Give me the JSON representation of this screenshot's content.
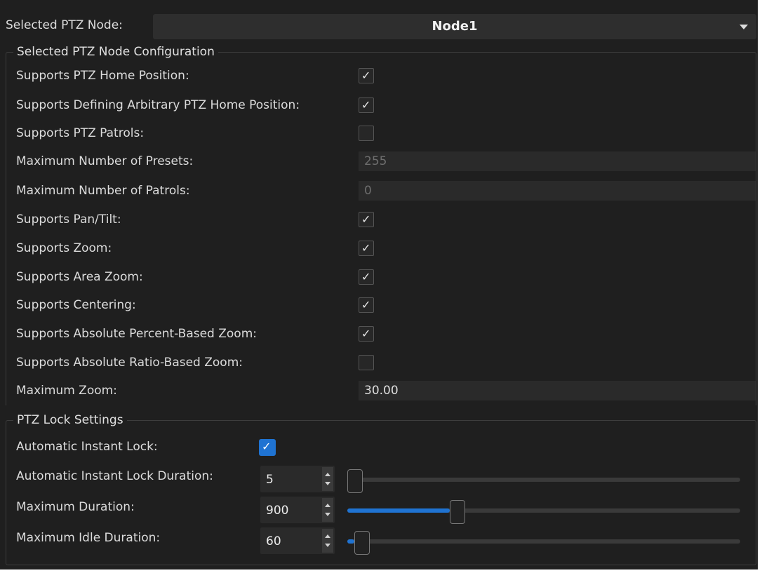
{
  "node": {
    "label": "Selected PTZ Node:",
    "selected": "Node1"
  },
  "config": {
    "legend": "Selected PTZ Node Configuration",
    "rows": [
      {
        "label": "Supports PTZ Home Position:",
        "type": "checkbox",
        "checked": true
      },
      {
        "label": "Supports Defining Arbitrary PTZ Home Position:",
        "type": "checkbox",
        "checked": true
      },
      {
        "label": "Supports PTZ Patrols:",
        "type": "checkbox",
        "checked": false
      },
      {
        "label": "Maximum Number of Presets:",
        "type": "field",
        "value": "255"
      },
      {
        "label": "Maximum Number of Patrols:",
        "type": "field",
        "value": "0"
      },
      {
        "label": "Supports Pan/Tilt:",
        "type": "checkbox",
        "checked": true
      },
      {
        "label": "Supports Zoom:",
        "type": "checkbox",
        "checked": true
      },
      {
        "label": "Supports Area Zoom:",
        "type": "checkbox",
        "checked": true
      },
      {
        "label": "Supports Centering:",
        "type": "checkbox",
        "checked": true
      },
      {
        "label": "Supports Absolute Percent-Based Zoom:",
        "type": "checkbox",
        "checked": true
      },
      {
        "label": "Supports Absolute Ratio-Based Zoom:",
        "type": "checkbox",
        "checked": false
      },
      {
        "label": "Maximum Zoom:",
        "type": "field",
        "value": "30.00"
      }
    ]
  },
  "lock": {
    "legend": "PTZ Lock Settings",
    "instant_lock": {
      "label": "Automatic Instant Lock:",
      "checked": true
    },
    "sliders": [
      {
        "label": "Automatic Instant Lock Duration:",
        "value": "5",
        "fraction": 0.0
      },
      {
        "label": "Maximum Duration:",
        "value": "900",
        "fraction": 0.26
      },
      {
        "label": "Maximum Idle Duration:",
        "value": "60",
        "fraction": 0.017
      }
    ]
  },
  "colors": {
    "accent": "#1f73d2",
    "panel": "#1f1f1f"
  }
}
